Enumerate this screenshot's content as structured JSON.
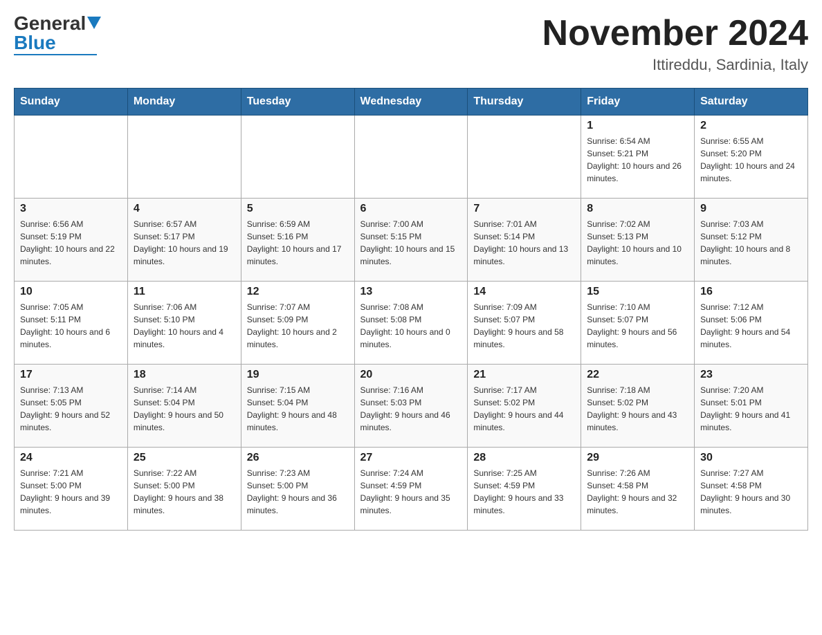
{
  "header": {
    "logo_general": "General",
    "logo_blue": "Blue",
    "month_title": "November 2024",
    "subtitle": "Ittireddu, Sardinia, Italy"
  },
  "days_of_week": [
    "Sunday",
    "Monday",
    "Tuesday",
    "Wednesday",
    "Thursday",
    "Friday",
    "Saturday"
  ],
  "weeks": [
    [
      {
        "day": "",
        "info": ""
      },
      {
        "day": "",
        "info": ""
      },
      {
        "day": "",
        "info": ""
      },
      {
        "day": "",
        "info": ""
      },
      {
        "day": "",
        "info": ""
      },
      {
        "day": "1",
        "info": "Sunrise: 6:54 AM\nSunset: 5:21 PM\nDaylight: 10 hours and 26 minutes."
      },
      {
        "day": "2",
        "info": "Sunrise: 6:55 AM\nSunset: 5:20 PM\nDaylight: 10 hours and 24 minutes."
      }
    ],
    [
      {
        "day": "3",
        "info": "Sunrise: 6:56 AM\nSunset: 5:19 PM\nDaylight: 10 hours and 22 minutes."
      },
      {
        "day": "4",
        "info": "Sunrise: 6:57 AM\nSunset: 5:17 PM\nDaylight: 10 hours and 19 minutes."
      },
      {
        "day": "5",
        "info": "Sunrise: 6:59 AM\nSunset: 5:16 PM\nDaylight: 10 hours and 17 minutes."
      },
      {
        "day": "6",
        "info": "Sunrise: 7:00 AM\nSunset: 5:15 PM\nDaylight: 10 hours and 15 minutes."
      },
      {
        "day": "7",
        "info": "Sunrise: 7:01 AM\nSunset: 5:14 PM\nDaylight: 10 hours and 13 minutes."
      },
      {
        "day": "8",
        "info": "Sunrise: 7:02 AM\nSunset: 5:13 PM\nDaylight: 10 hours and 10 minutes."
      },
      {
        "day": "9",
        "info": "Sunrise: 7:03 AM\nSunset: 5:12 PM\nDaylight: 10 hours and 8 minutes."
      }
    ],
    [
      {
        "day": "10",
        "info": "Sunrise: 7:05 AM\nSunset: 5:11 PM\nDaylight: 10 hours and 6 minutes."
      },
      {
        "day": "11",
        "info": "Sunrise: 7:06 AM\nSunset: 5:10 PM\nDaylight: 10 hours and 4 minutes."
      },
      {
        "day": "12",
        "info": "Sunrise: 7:07 AM\nSunset: 5:09 PM\nDaylight: 10 hours and 2 minutes."
      },
      {
        "day": "13",
        "info": "Sunrise: 7:08 AM\nSunset: 5:08 PM\nDaylight: 10 hours and 0 minutes."
      },
      {
        "day": "14",
        "info": "Sunrise: 7:09 AM\nSunset: 5:07 PM\nDaylight: 9 hours and 58 minutes."
      },
      {
        "day": "15",
        "info": "Sunrise: 7:10 AM\nSunset: 5:07 PM\nDaylight: 9 hours and 56 minutes."
      },
      {
        "day": "16",
        "info": "Sunrise: 7:12 AM\nSunset: 5:06 PM\nDaylight: 9 hours and 54 minutes."
      }
    ],
    [
      {
        "day": "17",
        "info": "Sunrise: 7:13 AM\nSunset: 5:05 PM\nDaylight: 9 hours and 52 minutes."
      },
      {
        "day": "18",
        "info": "Sunrise: 7:14 AM\nSunset: 5:04 PM\nDaylight: 9 hours and 50 minutes."
      },
      {
        "day": "19",
        "info": "Sunrise: 7:15 AM\nSunset: 5:04 PM\nDaylight: 9 hours and 48 minutes."
      },
      {
        "day": "20",
        "info": "Sunrise: 7:16 AM\nSunset: 5:03 PM\nDaylight: 9 hours and 46 minutes."
      },
      {
        "day": "21",
        "info": "Sunrise: 7:17 AM\nSunset: 5:02 PM\nDaylight: 9 hours and 44 minutes."
      },
      {
        "day": "22",
        "info": "Sunrise: 7:18 AM\nSunset: 5:02 PM\nDaylight: 9 hours and 43 minutes."
      },
      {
        "day": "23",
        "info": "Sunrise: 7:20 AM\nSunset: 5:01 PM\nDaylight: 9 hours and 41 minutes."
      }
    ],
    [
      {
        "day": "24",
        "info": "Sunrise: 7:21 AM\nSunset: 5:00 PM\nDaylight: 9 hours and 39 minutes."
      },
      {
        "day": "25",
        "info": "Sunrise: 7:22 AM\nSunset: 5:00 PM\nDaylight: 9 hours and 38 minutes."
      },
      {
        "day": "26",
        "info": "Sunrise: 7:23 AM\nSunset: 5:00 PM\nDaylight: 9 hours and 36 minutes."
      },
      {
        "day": "27",
        "info": "Sunrise: 7:24 AM\nSunset: 4:59 PM\nDaylight: 9 hours and 35 minutes."
      },
      {
        "day": "28",
        "info": "Sunrise: 7:25 AM\nSunset: 4:59 PM\nDaylight: 9 hours and 33 minutes."
      },
      {
        "day": "29",
        "info": "Sunrise: 7:26 AM\nSunset: 4:58 PM\nDaylight: 9 hours and 32 minutes."
      },
      {
        "day": "30",
        "info": "Sunrise: 7:27 AM\nSunset: 4:58 PM\nDaylight: 9 hours and 30 minutes."
      }
    ]
  ]
}
